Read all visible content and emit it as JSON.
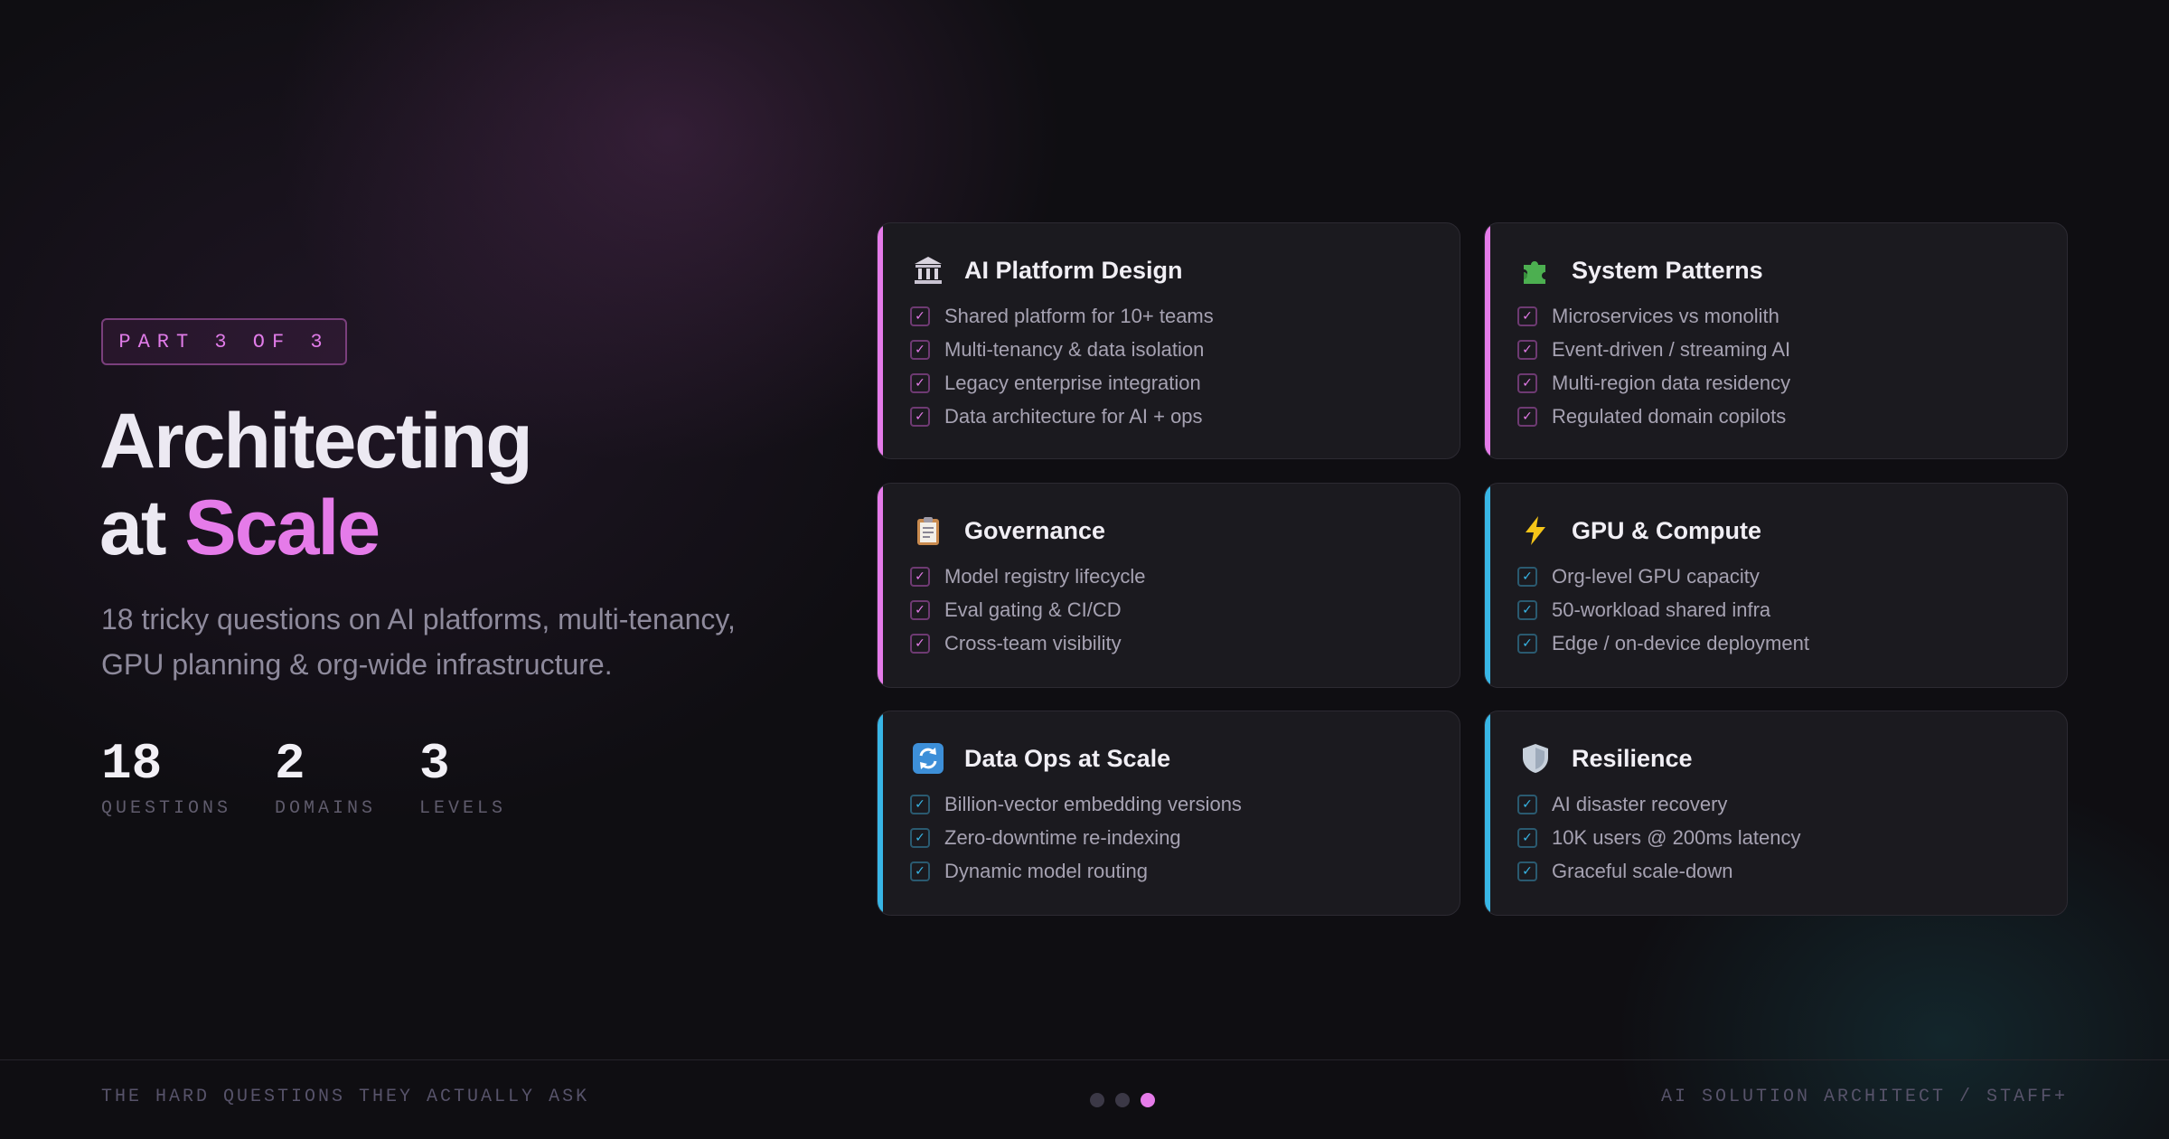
{
  "badge": "PART 3 OF 3",
  "headline": {
    "line1": "Architecting",
    "line2_prefix": "at ",
    "line2_accent": "Scale"
  },
  "subtitle": "18 tricky questions on AI platforms, multi-tenancy, GPU planning & org-wide infrastructure.",
  "stats": [
    {
      "value": "18",
      "label": "QUESTIONS"
    },
    {
      "value": "2",
      "label": "DOMAINS"
    },
    {
      "value": "3",
      "label": "LEVELS"
    }
  ],
  "colors": {
    "pink": "#e57be9",
    "cyan": "#38b6e6",
    "background": "#0f0e12",
    "card": "#1b1a1f"
  },
  "cards": [
    {
      "icon": "classical-building-icon",
      "title": "AI Platform Design",
      "accent": "pink",
      "items": [
        "Shared platform for 10+ teams",
        "Multi-tenancy & data isolation",
        "Legacy enterprise integration",
        "Data architecture for AI + ops"
      ]
    },
    {
      "icon": "puzzle-piece-icon",
      "title": "System Patterns",
      "accent": "pink",
      "items": [
        "Microservices vs monolith",
        "Event-driven / streaming AI",
        "Multi-region data residency",
        "Regulated domain copilots"
      ]
    },
    {
      "icon": "clipboard-icon",
      "title": "Governance",
      "accent": "pink",
      "items": [
        "Model registry lifecycle",
        "Eval gating & CI/CD",
        "Cross-team visibility"
      ]
    },
    {
      "icon": "lightning-icon",
      "title": "GPU & Compute",
      "accent": "cyan",
      "items": [
        "Org-level GPU capacity",
        "50-workload shared infra",
        "Edge / on-device deployment"
      ]
    },
    {
      "icon": "refresh-arrows-icon",
      "title": "Data Ops at Scale",
      "accent": "cyan",
      "items": [
        "Billion-vector embedding versions",
        "Zero-downtime re-indexing",
        "Dynamic model routing"
      ]
    },
    {
      "icon": "shield-icon",
      "title": "Resilience",
      "accent": "cyan",
      "items": [
        "AI disaster recovery",
        "10K users @ 200ms latency",
        "Graceful scale-down"
      ]
    }
  ],
  "footer": {
    "left": "THE HARD QUESTIONS THEY ACTUALLY ASK",
    "right": "AI SOLUTION ARCHITECT / STAFF+"
  },
  "pagination": {
    "total": 3,
    "current": 3
  }
}
